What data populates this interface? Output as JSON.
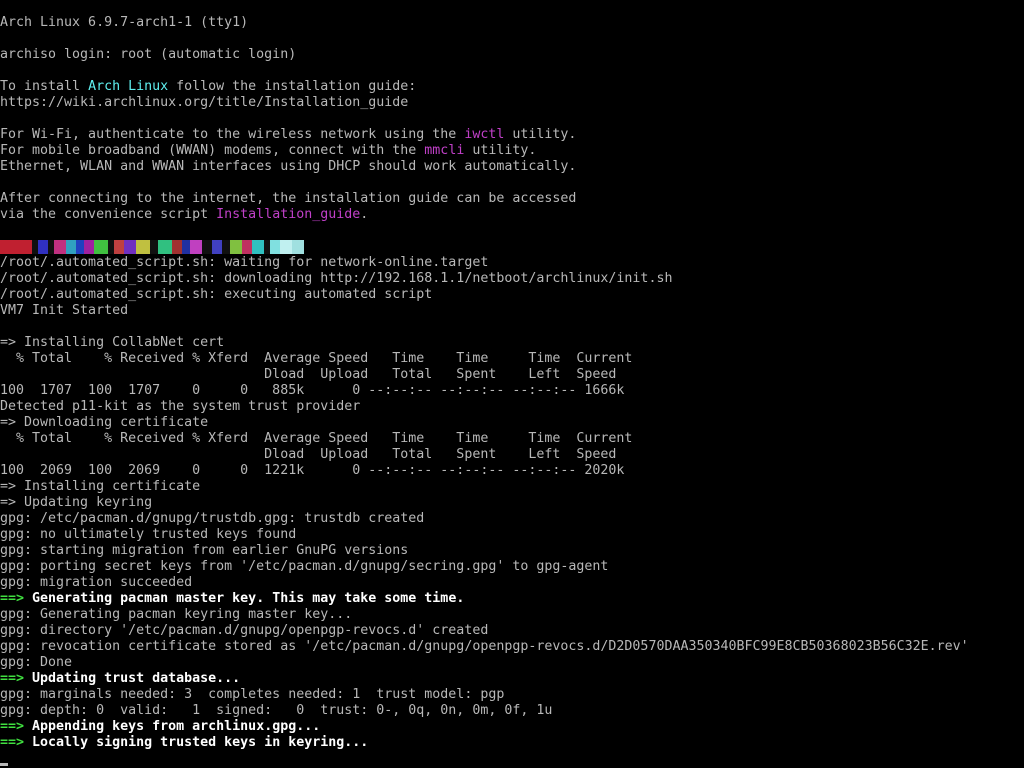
{
  "terminal": {
    "tty": "tty1",
    "lines": [
      {
        "segs": [
          {
            "t": "Arch Linux 6.9.7-arch1-1 (tty1)",
            "c": "plain"
          }
        ]
      },
      {
        "segs": []
      },
      {
        "segs": [
          {
            "t": "archiso login: root (automatic login)",
            "c": "plain"
          }
        ]
      },
      {
        "segs": []
      },
      {
        "segs": [
          {
            "t": "To install ",
            "c": "plain"
          },
          {
            "t": "Arch Linux",
            "c": "cyan"
          },
          {
            "t": " follow the installation guide:",
            "c": "plain"
          }
        ]
      },
      {
        "segs": [
          {
            "t": "https://wiki.archlinux.org/title/Installation_guide",
            "c": "plain"
          }
        ]
      },
      {
        "segs": []
      },
      {
        "segs": [
          {
            "t": "For Wi-Fi, authenticate to the wireless network using the ",
            "c": "plain"
          },
          {
            "t": "iwctl",
            "c": "magenta"
          },
          {
            "t": " utility.",
            "c": "plain"
          }
        ]
      },
      {
        "segs": [
          {
            "t": "For mobile broadband (WWAN) modems, connect with the ",
            "c": "plain"
          },
          {
            "t": "mmcli",
            "c": "magenta"
          },
          {
            "t": " utility.",
            "c": "plain"
          }
        ]
      },
      {
        "segs": [
          {
            "t": "Ethernet, WLAN and WWAN interfaces using DHCP should work automatically.",
            "c": "plain"
          }
        ]
      },
      {
        "segs": []
      },
      {
        "segs": [
          {
            "t": "After connecting to the internet, the installation guide can be accessed",
            "c": "plain"
          }
        ]
      },
      {
        "segs": [
          {
            "t": "via the convenience script ",
            "c": "plain"
          },
          {
            "t": "Installation_guide",
            "c": "magenta"
          },
          {
            "t": ".",
            "c": "plain"
          }
        ]
      },
      {
        "segs": []
      },
      {
        "segs": []
      },
      {
        "segs": [
          {
            "t": "/root/.automated_script.sh: waiting for network-online.target",
            "c": "plain"
          }
        ]
      },
      {
        "segs": [
          {
            "t": "/root/.automated_script.sh: downloading http://192.168.1.1/netboot/archlinux/init.sh",
            "c": "plain"
          }
        ]
      },
      {
        "segs": [
          {
            "t": "/root/.automated_script.sh: executing automated script",
            "c": "plain"
          }
        ]
      },
      {
        "segs": [
          {
            "t": "VM7 Init Started",
            "c": "plain"
          }
        ]
      },
      {
        "segs": []
      },
      {
        "segs": [
          {
            "t": "=> Installing CollabNet cert",
            "c": "plain"
          }
        ]
      },
      {
        "segs": [
          {
            "t": "  % Total    % Received % Xferd  Average Speed   Time    Time     Time  Current",
            "c": "plain"
          }
        ]
      },
      {
        "segs": [
          {
            "t": "                                 Dload  Upload   Total   Spent    Left  Speed",
            "c": "plain"
          }
        ]
      },
      {
        "segs": [
          {
            "t": "100  1707  100  1707    0     0   885k      0 --:--:-- --:--:-- --:--:-- 1666k",
            "c": "plain"
          }
        ]
      },
      {
        "segs": [
          {
            "t": "Detected p11-kit as the system trust provider",
            "c": "plain"
          }
        ]
      },
      {
        "segs": [
          {
            "t": "=> Downloading certificate",
            "c": "plain"
          }
        ]
      },
      {
        "segs": [
          {
            "t": "  % Total    % Received % Xferd  Average Speed   Time    Time     Time  Current",
            "c": "plain"
          }
        ]
      },
      {
        "segs": [
          {
            "t": "                                 Dload  Upload   Total   Spent    Left  Speed",
            "c": "plain"
          }
        ]
      },
      {
        "segs": [
          {
            "t": "100  2069  100  2069    0     0  1221k      0 --:--:-- --:--:-- --:--:-- 2020k",
            "c": "plain"
          }
        ]
      },
      {
        "segs": [
          {
            "t": "=> Installing certificate",
            "c": "plain"
          }
        ]
      },
      {
        "segs": [
          {
            "t": "=> Updating keyring",
            "c": "plain"
          }
        ]
      },
      {
        "segs": [
          {
            "t": "gpg: /etc/pacman.d/gnupg/trustdb.gpg: trustdb created",
            "c": "plain"
          }
        ]
      },
      {
        "segs": [
          {
            "t": "gpg: no ultimately trusted keys found",
            "c": "plain"
          }
        ]
      },
      {
        "segs": [
          {
            "t": "gpg: starting migration from earlier GnuPG versions",
            "c": "plain"
          }
        ]
      },
      {
        "segs": [
          {
            "t": "gpg: porting secret keys from '/etc/pacman.d/gnupg/secring.gpg' to gpg-agent",
            "c": "plain"
          }
        ]
      },
      {
        "segs": [
          {
            "t": "gpg: migration succeeded",
            "c": "plain"
          }
        ]
      },
      {
        "segs": [
          {
            "t": "==>",
            "c": "green"
          },
          {
            "t": " Generating pacman master key. This may take some time.",
            "c": "bold"
          }
        ]
      },
      {
        "segs": [
          {
            "t": "gpg: Generating pacman keyring master key...",
            "c": "plain"
          }
        ]
      },
      {
        "segs": [
          {
            "t": "gpg: directory '/etc/pacman.d/gnupg/openpgp-revocs.d' created",
            "c": "plain"
          }
        ]
      },
      {
        "segs": [
          {
            "t": "gpg: revocation certificate stored as '/etc/pacman.d/gnupg/openpgp-revocs.d/D2D0570DAA350340BFC99E8CB50368023B56C32E.rev'",
            "c": "plain"
          }
        ]
      },
      {
        "segs": [
          {
            "t": "gpg: Done",
            "c": "plain"
          }
        ]
      },
      {
        "segs": [
          {
            "t": "==>",
            "c": "green"
          },
          {
            "t": " Updating trust database...",
            "c": "bold"
          }
        ]
      },
      {
        "segs": [
          {
            "t": "gpg: marginals needed: 3  completes needed: 1  trust model: pgp",
            "c": "plain"
          }
        ]
      },
      {
        "segs": [
          {
            "t": "gpg: depth: 0  valid:   1  signed:   0  trust: 0-, 0q, 0n, 0m, 0f, 1u",
            "c": "plain"
          }
        ]
      },
      {
        "segs": [
          {
            "t": "==>",
            "c": "green"
          },
          {
            "t": " Appending keys from archlinux.gpg...",
            "c": "bold"
          }
        ]
      },
      {
        "segs": [
          {
            "t": "==>",
            "c": "green"
          },
          {
            "t": " Locally signing trusted keys in keyring...",
            "c": "bold"
          }
        ]
      }
    ],
    "glitch_colors": [
      "#c02030",
      "#c02030",
      "#101010",
      "#3030c0",
      "#101010",
      "#c03080",
      "#30a0c0",
      "#2040c0",
      "#a020a0",
      "#40c040",
      "#101010",
      "#c04040",
      "#7030c0",
      "#c0c040",
      "#101010",
      "#30c080",
      "#a03030",
      "#2030a0",
      "#c040c0",
      "#101010",
      "#4040c0",
      "#101010",
      "#80c040",
      "#c03060",
      "#30c0c0",
      "#101010",
      "#80e0e0",
      "#c0f0f0",
      "#a0e0e0"
    ],
    "colors": {
      "background": "#000000",
      "text": "#b8b8b8",
      "cyan": "#5ff0f0",
      "magenta": "#c040c8",
      "green": "#40e040",
      "bold": "#ffffff"
    }
  }
}
